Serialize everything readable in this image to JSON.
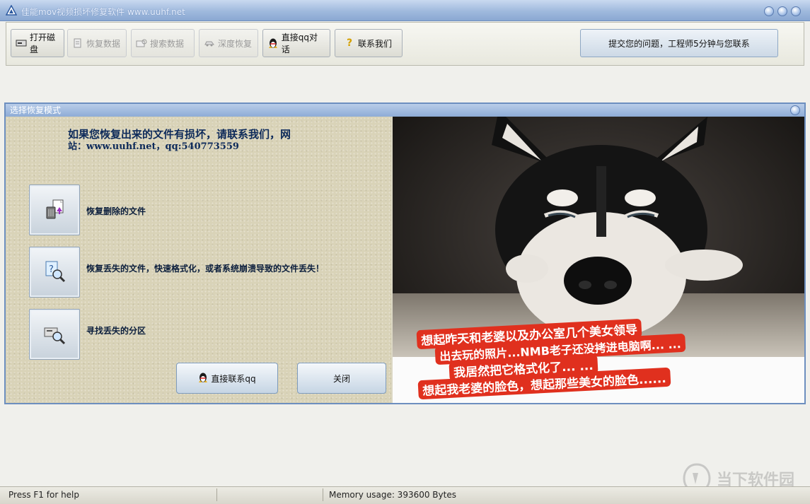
{
  "window": {
    "title": "佳能mov视频损坏修复软件 www.uuhf.net"
  },
  "toolbar": {
    "open_disk": "打开磁盘",
    "recover_data": "恢复数据",
    "search_data": "搜索数据",
    "deep_recover": "深度恢复",
    "qq_chat": "直接qq对话",
    "contact_us": "联系我们",
    "submit_question": "提交您的问题，工程师5分钟与您联系"
  },
  "dialog": {
    "title": "选择恢复模式",
    "info_line1": "如果您恢复出来的文件有损坏，请联系我们，网",
    "info_line2": "站：www.uuhf.net，qq:540773559",
    "options": [
      {
        "label": "恢复删除的文件"
      },
      {
        "label": "恢复丢失的文件，快速格式化，或者系统崩溃导致的文件丢失！"
      },
      {
        "label": "寻找丢失的分区"
      }
    ],
    "contact_qq_button": "直接联系qq",
    "close_button": "关闭"
  },
  "photo": {
    "caption_lines": [
      "想起昨天和老婆以及办公室几个美女领导",
      "出去玩的照片...NMB老子还没拷进电脑啊... ...",
      "我居然把它格式化了... ...",
      "想起我老婆的脸色，想起那些美女的脸色......"
    ]
  },
  "statusbar": {
    "help": "Press F1 for help",
    "memory": "Memory usage: 393600 Bytes"
  },
  "watermark": {
    "text": "当下软件园"
  },
  "colors": {
    "titlebar": "#9fb9dd",
    "caption_bg": "#e0301e",
    "info_text": "#0d2a5a"
  }
}
